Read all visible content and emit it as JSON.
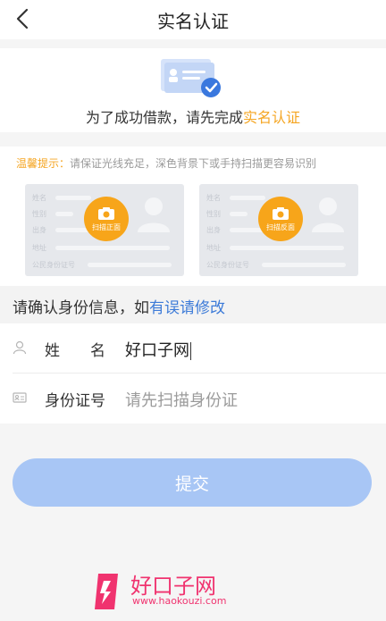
{
  "header": {
    "title": "实名认证",
    "back_icon": "chevron-left-icon"
  },
  "hero": {
    "text_prefix": "为了成功借款，请先完成",
    "text_highlight": "实名认证",
    "icon": "id-card-verified-icon"
  },
  "scan": {
    "tip_label": "温馨提示：",
    "tip_text": "请保证光线充足，深色背景下或手持扫描更容易识别",
    "card_fields": [
      "姓名",
      "性别",
      "出身",
      "地址",
      "公民身份证号"
    ],
    "front_label": "扫描正面",
    "back_label": "扫描反面"
  },
  "confirm": {
    "text": "请确认身份信息，如",
    "link": "有误请修改"
  },
  "form": {
    "name_label": "姓　　名",
    "name_value": "好口子网",
    "id_label": "身份证号",
    "id_placeholder": "请先扫描身份证"
  },
  "submit_label": "提交",
  "watermark": {
    "name": "好口子网",
    "url": "www.haokouzi.com"
  },
  "colors": {
    "accent": "#f5a623",
    "link": "#3d7bd8",
    "button": "#a8c6f5",
    "watermark": "#f0336f"
  }
}
